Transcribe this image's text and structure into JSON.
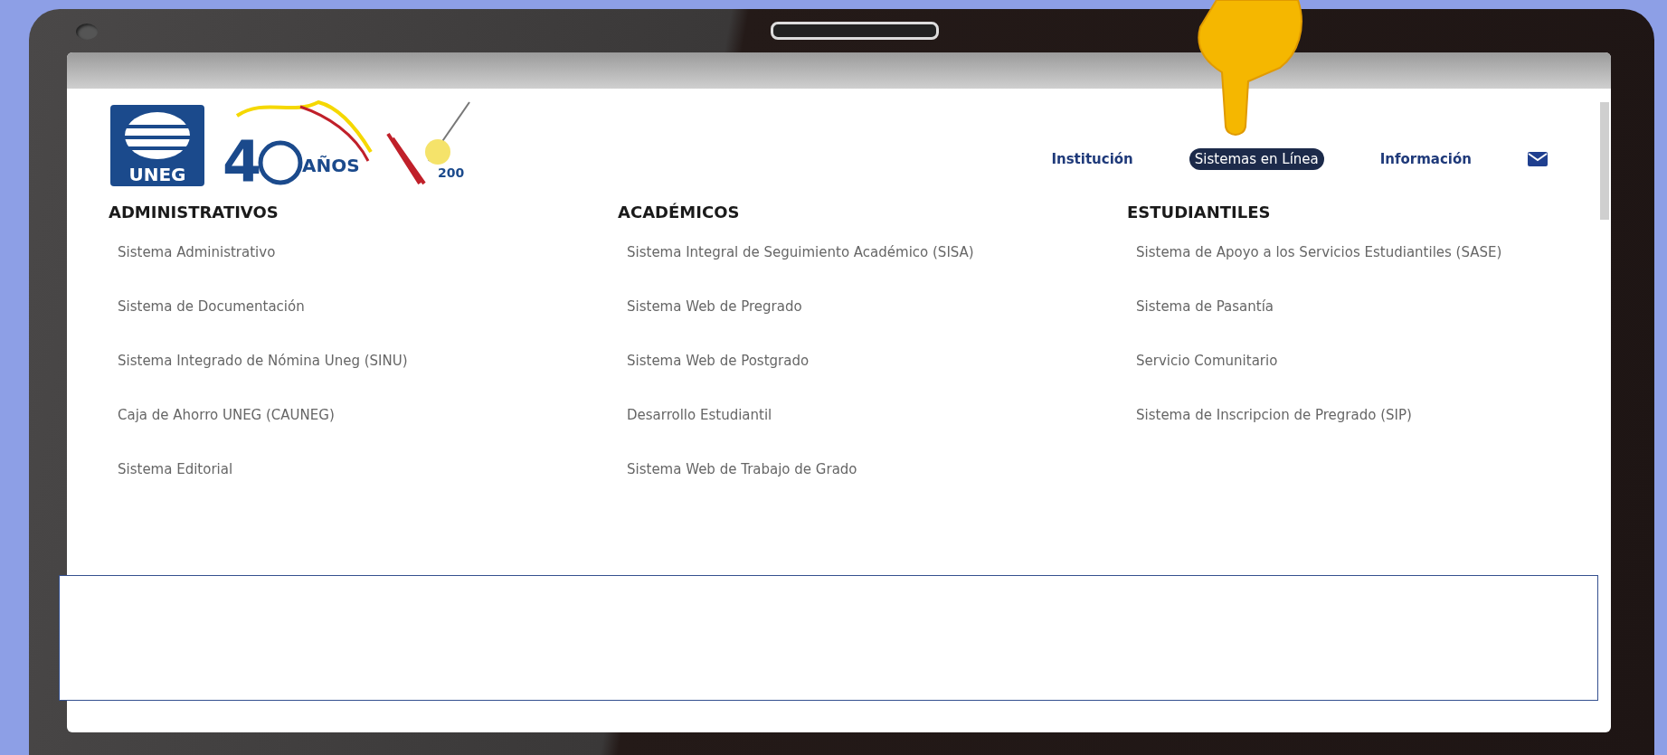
{
  "logos": [
    {
      "kind": "uneg",
      "text": "UNEG"
    },
    {
      "kind": "anniversary",
      "text": "4",
      "suffix": "AÑOS"
    },
    {
      "kind": "bicentennial",
      "text": "200"
    }
  ],
  "nav": [
    {
      "kind": "link",
      "label": "Institución",
      "selected": false
    },
    {
      "kind": "link",
      "label": "Sistemas en Línea",
      "selected": true
    },
    {
      "kind": "link",
      "label": "Información",
      "selected": false
    },
    {
      "kind": "mail"
    }
  ],
  "columns": [
    {
      "heading": "ADMINISTRATIVOS",
      "items": [
        "Sistema Administrativo",
        "Sistema de Documentación",
        "Sistema Integrado de Nómina Uneg (SINU)",
        "Caja de Ahorro UNEG (CAUNEG)",
        "Sistema Editorial"
      ]
    },
    {
      "heading": "ACADÉMICOS",
      "items": [
        "Sistema Integral de Seguimiento Académico (SISA)",
        "Sistema Web de Pregrado",
        "Sistema Web de Postgrado",
        "Desarrollo Estudiantil",
        "Sistema Web de Trabajo de Grado"
      ]
    },
    {
      "heading": "ESTUDIANTILES",
      "items": [
        "Sistema de Apoyo a los Servicios Estudiantiles (SASE)",
        "Sistema de Pasantía",
        "Servicio Comunitario",
        "Sistema de Inscripcion de Pregrado (SIP)"
      ]
    }
  ]
}
